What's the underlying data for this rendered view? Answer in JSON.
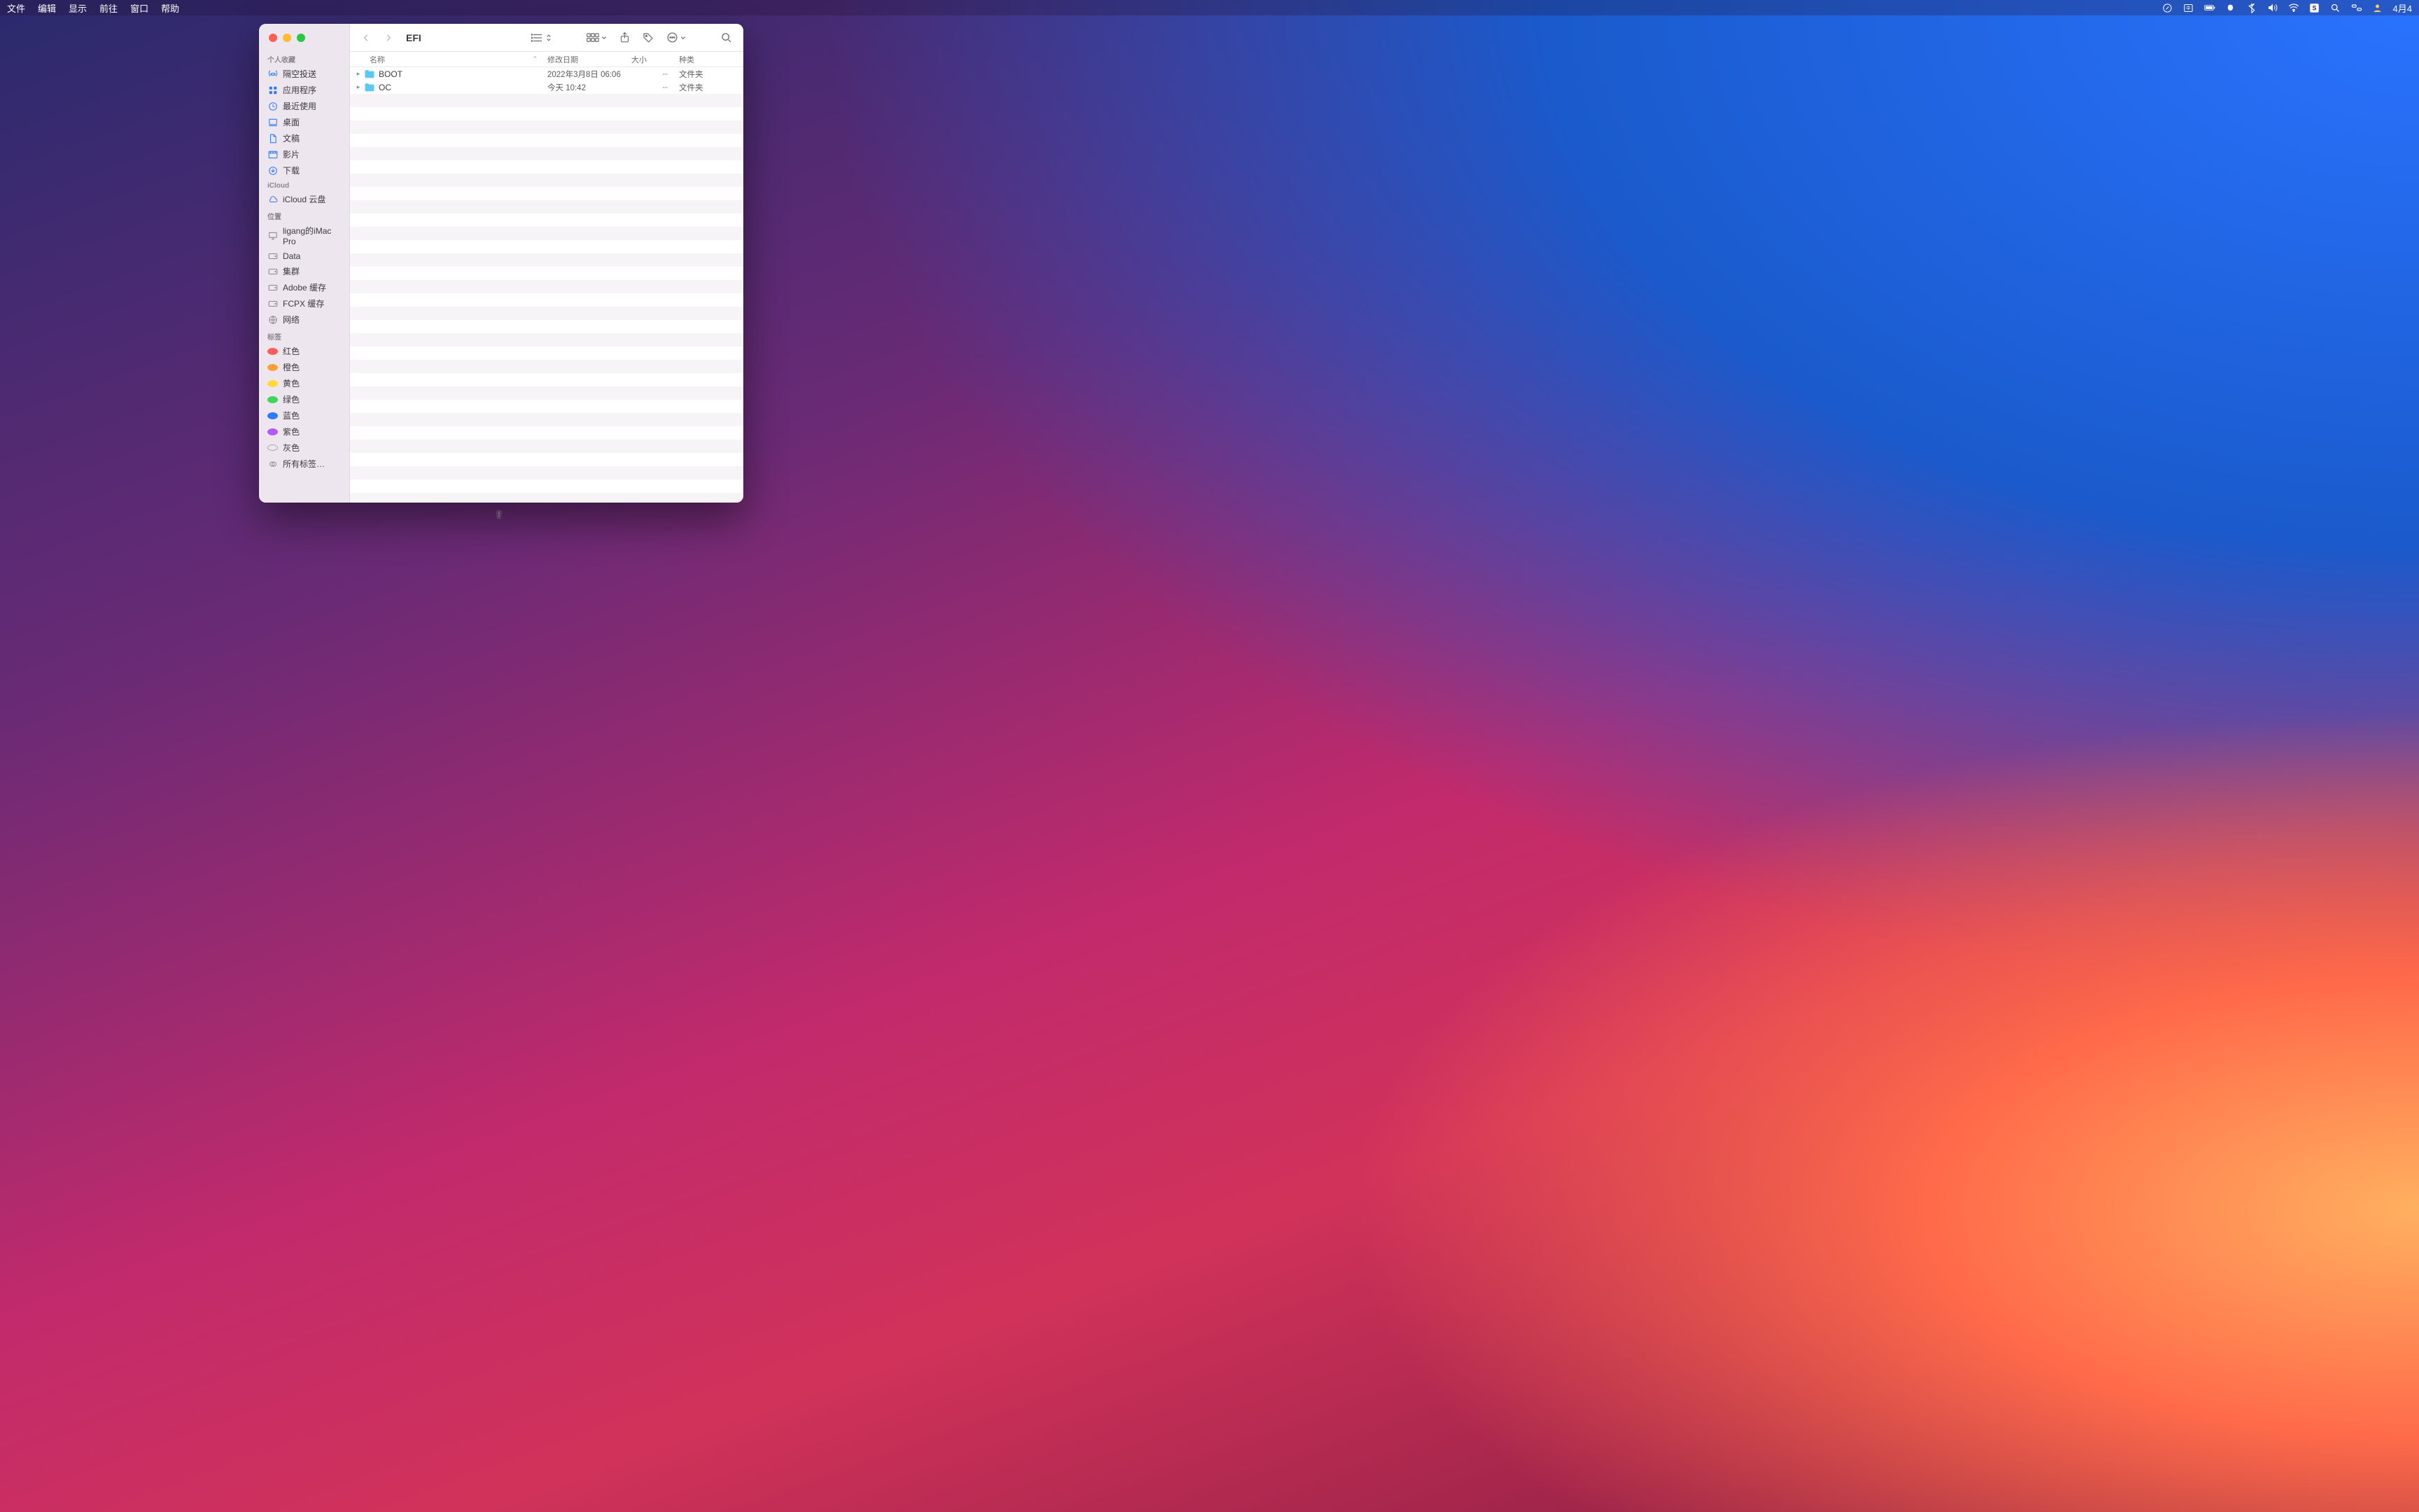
{
  "menubar": {
    "items": [
      "文件",
      "编辑",
      "显示",
      "前往",
      "窗口",
      "帮助"
    ],
    "date": "4月4"
  },
  "window": {
    "title": "EFI"
  },
  "sidebar": {
    "sections": [
      {
        "title": "个人收藏",
        "items": [
          {
            "icon": "airdrop",
            "label": "隔空投送"
          },
          {
            "icon": "apps",
            "label": "应用程序"
          },
          {
            "icon": "recent",
            "label": "最近使用"
          },
          {
            "icon": "desktop",
            "label": "桌面"
          },
          {
            "icon": "doc",
            "label": "文稿"
          },
          {
            "icon": "movie",
            "label": "影片"
          },
          {
            "icon": "download",
            "label": "下载"
          }
        ]
      },
      {
        "title": "iCloud",
        "items": [
          {
            "icon": "cloud",
            "label": "iCloud 云盘"
          }
        ]
      },
      {
        "title": "位置",
        "items": [
          {
            "icon": "computer",
            "label": "ligang的iMac Pro"
          },
          {
            "icon": "disk",
            "label": "Data"
          },
          {
            "icon": "disk",
            "label": "集群"
          },
          {
            "icon": "disk",
            "label": "Adobe 缓存"
          },
          {
            "icon": "disk",
            "label": "FCPX 缓存"
          },
          {
            "icon": "network",
            "label": "网络"
          }
        ]
      },
      {
        "title": "标签",
        "items": [
          {
            "color": "#ff5b5b",
            "label": "红色"
          },
          {
            "color": "#ff9f3a",
            "label": "橙色"
          },
          {
            "color": "#ffd93a",
            "label": "黄色"
          },
          {
            "color": "#3fd45b",
            "label": "绿色"
          },
          {
            "color": "#2f7bff",
            "label": "蓝色"
          },
          {
            "color": "#b45bff",
            "label": "紫色"
          },
          {
            "color": "#a7a7a7",
            "label": "灰色",
            "gray": true
          },
          {
            "alltags": true,
            "label": "所有标签…"
          }
        ]
      }
    ]
  },
  "columns": {
    "name": "名称",
    "date": "修改日期",
    "size": "大小",
    "kind": "种类"
  },
  "files": [
    {
      "name": "BOOT",
      "date": "2022年3月8日 06:06",
      "size": "--",
      "kind": "文件夹"
    },
    {
      "name": "OC",
      "date": "今天 10:42",
      "size": "--",
      "kind": "文件夹"
    }
  ],
  "colors": {
    "folder": "#5ac8fa"
  }
}
